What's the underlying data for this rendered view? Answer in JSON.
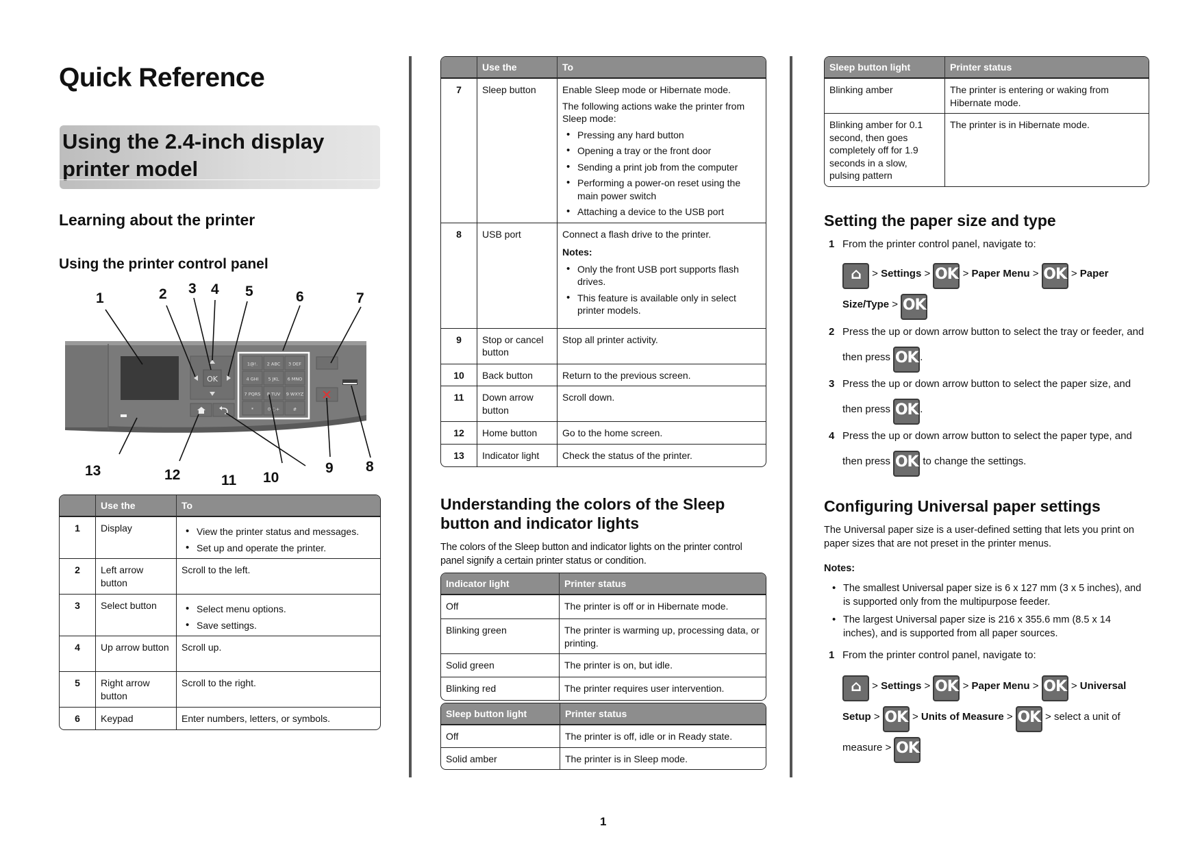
{
  "page": {
    "title": "Quick Reference",
    "banner": "Using the 2.4-inch display printer model",
    "page_number": "1"
  },
  "col1": {
    "section": "Learning about the printer",
    "subsection": "Using the printer control panel",
    "figure": {
      "callouts": [
        "1",
        "2",
        "3",
        "4",
        "5",
        "6",
        "7",
        "8",
        "9",
        "10",
        "11",
        "12",
        "13"
      ],
      "keypad": [
        [
          "1@!.",
          "2 ABC",
          "3 DEF"
        ],
        [
          "4 GHI",
          "5 JKL",
          "6 MNO"
        ],
        [
          "7 PQRS",
          "8 TUV",
          "9 WXYZ"
        ],
        [
          "*",
          "0 ◌+",
          "#"
        ]
      ],
      "ok_label": "OK"
    },
    "table": {
      "headers": [
        "",
        "Use the",
        "To"
      ],
      "rows": [
        {
          "num": "1",
          "item": "Display",
          "bullets": [
            "View the printer status and messages.",
            "Set up and operate the printer."
          ]
        },
        {
          "num": "2",
          "item": "Left arrow button",
          "text": "Scroll to the left."
        },
        {
          "num": "3",
          "item": "Select button",
          "bullets": [
            "Select menu options.",
            "Save settings."
          ]
        },
        {
          "num": "4",
          "item": "Up arrow button",
          "text": "Scroll up."
        },
        {
          "num": "5",
          "item": "Right arrow button",
          "text": "Scroll to the right."
        },
        {
          "num": "6",
          "item": "Keypad",
          "text": "Enter numbers, letters, or symbols."
        }
      ]
    }
  },
  "col2": {
    "table": {
      "headers": [
        "",
        "Use the",
        "To"
      ],
      "rows": [
        {
          "num": "7",
          "item": "Sleep button",
          "text": "Enable Sleep mode or Hibernate mode.",
          "text2": "The following actions wake the printer from Sleep mode:",
          "bullets": [
            "Pressing any hard button",
            "Opening a tray or the front door",
            "Sending a print job from the computer",
            "Performing a power-on reset using the main power switch",
            "Attaching a device to the USB port"
          ]
        },
        {
          "num": "8",
          "item": "USB port",
          "text": "Connect a flash drive to the printer.",
          "notes_label": "Notes:",
          "bullets": [
            "Only the front USB port supports flash drives.",
            "This feature is available only in select printer models."
          ]
        },
        {
          "num": "9",
          "item": "Stop or cancel button",
          "text": "Stop all printer activity."
        },
        {
          "num": "10",
          "item": "Back button",
          "text": "Return to the previous screen."
        },
        {
          "num": "11",
          "item": "Down arrow button",
          "text": "Scroll down."
        },
        {
          "num": "12",
          "item": "Home button",
          "text": "Go to the home screen."
        },
        {
          "num": "13",
          "item": "Indicator light",
          "text": "Check the status of the printer."
        }
      ]
    },
    "section": "Understanding the colors of the Sleep button and indicator lights",
    "intro": "The colors of the Sleep button and indicator lights on the printer control panel signify a certain printer status or condition.",
    "indicator_table": {
      "headers": [
        "Indicator light",
        "Printer status"
      ],
      "rows": [
        [
          "Off",
          "The printer is off or in Hibernate mode."
        ],
        [
          "Blinking green",
          "The printer is warming up, processing data, or printing."
        ],
        [
          "Solid green",
          "The printer is on, but idle."
        ],
        [
          "Blinking red",
          "The printer requires user intervention."
        ]
      ]
    },
    "sleep_table": {
      "headers": [
        "Sleep button light",
        "Printer status"
      ],
      "rows": [
        [
          "Off",
          "The printer is off, idle or in Ready state."
        ],
        [
          "Solid amber",
          "The printer is in Sleep mode."
        ]
      ]
    }
  },
  "col3": {
    "sleep_table": {
      "headers": [
        "Sleep button light",
        "Printer status"
      ],
      "rows": [
        [
          "Blinking amber",
          "The printer is entering or waking from Hibernate mode."
        ],
        [
          "Blinking amber for 0.1 second, then goes completely off for 1.9 seconds in a slow, pulsing pattern",
          "The printer is in Hibernate mode."
        ]
      ]
    },
    "paper_section": {
      "title": "Setting the paper size and type",
      "steps": [
        {
          "n": "1",
          "text": "From the printer control panel, navigate to:"
        },
        {
          "n": "2",
          "text": "Press the up or down arrow button to select the tray or feeder, and",
          "then": "then press",
          "after": "."
        },
        {
          "n": "3",
          "text": "Press the up or down arrow button to select the paper size, and",
          "then": "then press",
          "after": "."
        },
        {
          "n": "4",
          "text": "Press the up or down arrow button to select the paper type, and",
          "then": "then press",
          "after": "to change the settings."
        }
      ],
      "nav": {
        "sep": ">",
        "settings": "Settings",
        "paper_menu": "Paper Menu",
        "paper": "Paper",
        "size_type": "Size/Type"
      }
    },
    "universal_section": {
      "title": "Configuring Universal paper settings",
      "intro": "The Universal paper size is a user-defined setting that lets you print on paper sizes that are not preset in the printer menus.",
      "notes_label": "Notes:",
      "notes": [
        "The smallest Universal paper size is 6 x 127 mm (3 x 5 inches), and is supported only from the multipurpose feeder.",
        "The largest Universal paper size is 216 x 355.6 mm (8.5 x 14 inches), and is supported from all paper sources."
      ],
      "step1": {
        "n": "1",
        "text": "From the printer control panel, navigate to:"
      },
      "nav": {
        "settings": "Settings",
        "paper_menu": "Paper Menu",
        "universal": "Universal",
        "setup": "Setup",
        "units": "Units of Measure",
        "select_unit": "select a unit of",
        "measure": "measure"
      }
    }
  },
  "icons": {
    "ok": "OK"
  }
}
